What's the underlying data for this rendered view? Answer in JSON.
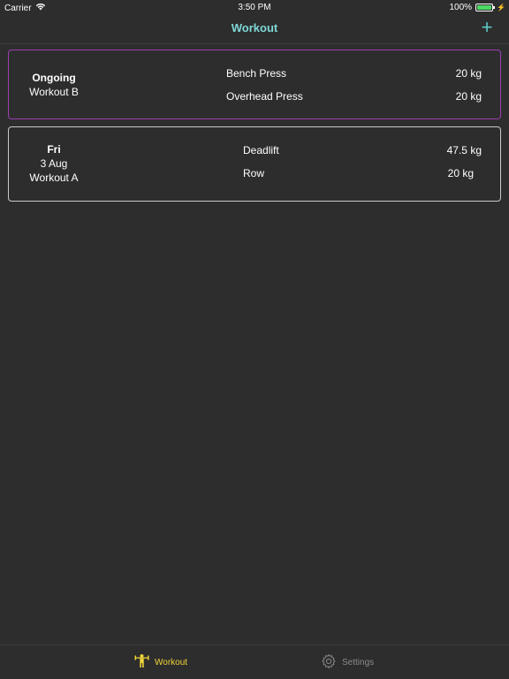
{
  "status": {
    "carrier": "Carrier",
    "time": "3:50 PM",
    "battery": "100%"
  },
  "nav": {
    "title": "Workout",
    "add_label": "+"
  },
  "workouts": [
    {
      "day": "Ongoing",
      "date": "",
      "name": "Workout B",
      "exercises": [
        {
          "name": "Bench Press",
          "weight": "20 kg"
        },
        {
          "name": "Overhead Press",
          "weight": "20 kg"
        }
      ]
    },
    {
      "day": "Fri",
      "date": "3 Aug",
      "name": "Workout A",
      "exercises": [
        {
          "name": "Deadlift",
          "weight": "47.5 kg"
        },
        {
          "name": "Row",
          "weight": "20 kg"
        }
      ]
    }
  ],
  "tabs": [
    {
      "label": "Workout",
      "icon": "lifter-icon",
      "color": "#f0d43a"
    },
    {
      "label": "Settings",
      "icon": "gear-icon",
      "color": "#8a8a8a"
    }
  ],
  "colors": {
    "background": "#2d2d2d",
    "accent": "#7fd6d6",
    "ongoing_border": "#9b3fb0",
    "card_border": "#c9c9c9",
    "battery": "#4cd964"
  }
}
